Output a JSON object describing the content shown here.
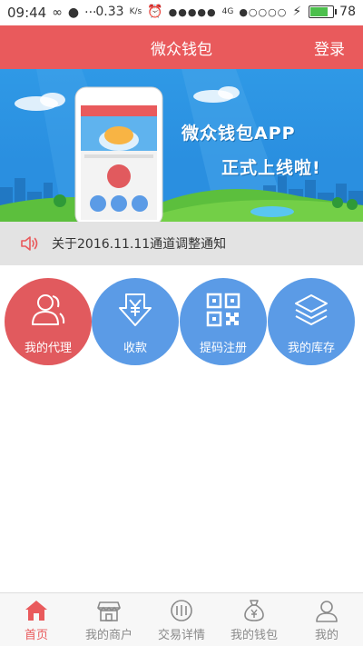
{
  "status_bar": {
    "time": "09:44",
    "speed": "0.33",
    "speed_unit": "K/s",
    "network": "4G",
    "battery": "78",
    "battery_level": 0.78
  },
  "header": {
    "title": "微众钱包",
    "login_label": "登录"
  },
  "banner": {
    "slogan_line1": "微众钱包APP",
    "slogan_line2": "正式上线啦!"
  },
  "notice": {
    "icon": "speaker-icon",
    "text": "关于2016.11.11通道调整通知"
  },
  "actions": [
    {
      "label": "我的代理",
      "icon": "users-icon",
      "color": "#e15a5e"
    },
    {
      "label": "收款",
      "icon": "yuan-receive-icon",
      "color": "#5b9be6"
    },
    {
      "label": "提码注册",
      "icon": "qr-code-icon",
      "color": "#5b9be6"
    },
    {
      "label": "我的库存",
      "icon": "layers-icon",
      "color": "#5b9be6"
    }
  ],
  "tabs": [
    {
      "label": "首页",
      "icon": "home-icon",
      "active": true
    },
    {
      "label": "我的商户",
      "icon": "store-icon",
      "active": false
    },
    {
      "label": "交易详情",
      "icon": "transactions-icon",
      "active": false
    },
    {
      "label": "我的钱包",
      "icon": "wallet-icon",
      "active": false
    },
    {
      "label": "我的",
      "icon": "user-icon",
      "active": false
    }
  ],
  "colors": {
    "accent": "#e95a5c",
    "blue": "#5b9be6",
    "tab_inactive": "#8a8a8a"
  }
}
